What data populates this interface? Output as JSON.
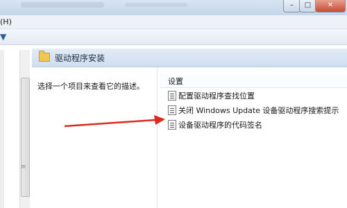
{
  "menu": {
    "help_label": "(H)"
  },
  "window": {
    "min": "–",
    "max": "□",
    "close": "✕"
  },
  "header": {
    "title": "驱动程序安装"
  },
  "description": {
    "text": "选择一个项目来查看它的描述。"
  },
  "list": {
    "column_header": "设置",
    "items": [
      {
        "label": "配置驱动程序查找位置"
      },
      {
        "label": "关闭 Windows Update 设备驱动程序搜索提示"
      },
      {
        "label": "设备驱动程序的代码签名"
      }
    ]
  },
  "annotation": {
    "arrow_color": "#e0281e"
  },
  "icons": {
    "folder": "folder-icon",
    "setting": "policy-setting-icon",
    "toolbar": "filter-icon"
  }
}
